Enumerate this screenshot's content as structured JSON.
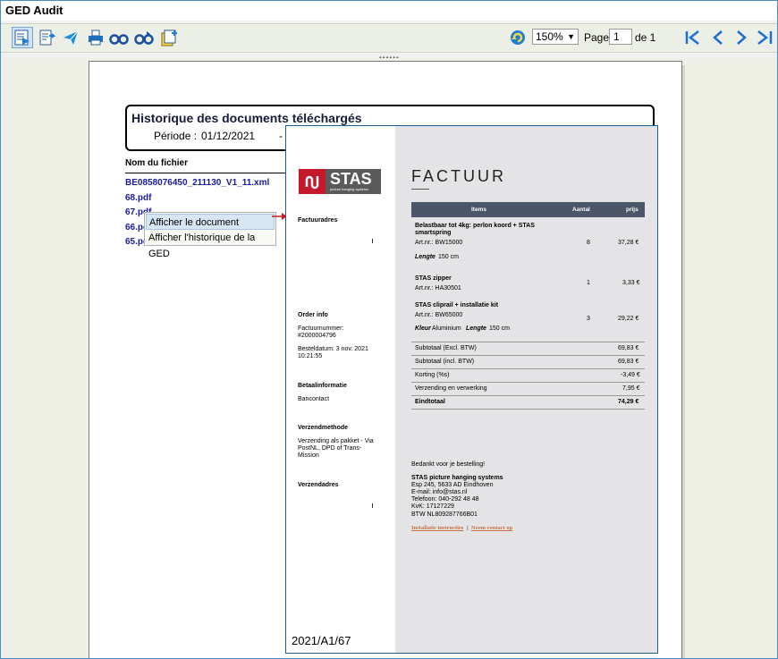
{
  "app": {
    "title": "GED Audit"
  },
  "toolbar": {
    "zoom_value": "150%",
    "page_label": "Page",
    "page_value": "1",
    "page_of": "de 1"
  },
  "report": {
    "title": "Historique des documents téléchargés",
    "period_label": "Période :",
    "period_start": "01/12/2021",
    "period_sep": "-",
    "column_header": "Nom du fichier",
    "files": [
      "BE0858076450_211130_V1_11.xml",
      "68.pdf",
      "67.pdf",
      "66.pdf",
      "65.pdf"
    ]
  },
  "context_menu": {
    "items": [
      "Afficher le document",
      "Afficher l'historique de la GED"
    ]
  },
  "invoice": {
    "logo_text": "STAS",
    "logo_sub": "picture hanging systems",
    "title": "FACTUUR",
    "billing_address_label": "Factuuradres",
    "order_info_label": "Order info",
    "invoice_number_label": "Factuurnummer:",
    "invoice_number": "#2000004796",
    "order_date_label": "Besteldatum: 3 nov. 2021",
    "order_time": "10:21:55",
    "payment_label": "Betaalinformatie",
    "payment_value": "Bancontact",
    "shipping_method_label": "Verzendmethode",
    "shipping_method_l1": "Verzending als pakket - Via",
    "shipping_method_l2": "PostNL, DPD of Trans-",
    "shipping_method_l3": "Mission",
    "shipping_address_label": "Verzendadres",
    "table_headers": {
      "items": "Items",
      "qty": "Aantal",
      "price": "prijs"
    },
    "item1_name_l1": "Belastbaar tot 4kg: perlon koord + STAS",
    "item1_name_l2": "smartspring",
    "item1_art": "Art.nr.: BW15000",
    "item1_qty": "8",
    "item1_price": "37,28 €",
    "item1_opt_label": "Lengte",
    "item1_opt_value": "150 cm",
    "item2_name": "STAS zipper",
    "item2_art": "Art.nr.: HA30501",
    "item2_qty": "1",
    "item2_price": "3,33 €",
    "item3_name": "STAS cliprail + installatie kit",
    "item3_art": "Art.nr.: BW65000",
    "item3_qty": "3",
    "item3_price": "29,22 €",
    "item3_opt1_label": "Kleur",
    "item3_opt1_value": "Aluminium",
    "item3_opt2_label": "Lengte",
    "item3_opt2_value": "150 cm",
    "subtotal_excl_label": "Subtotaal (Excl. BTW)",
    "subtotal_excl": "69,83 €",
    "subtotal_incl_label": "Subtotaal (incl. BTW)",
    "subtotal_incl": "69,83 €",
    "discount_label": "Korting (%s)",
    "discount": "-3,49 €",
    "shipping_label": "Verzending en verwerking",
    "shipping": "7,95 €",
    "total_label": "Eindtotaal",
    "total": "74,29 €",
    "thanks": "Bedankt voor je bestelling!",
    "company_name": "STAS picture hanging systems",
    "company_address": "Esp 245, 5633 AD Eindhoven",
    "company_email": "E-mail: info@stas.nl",
    "company_phone": "Telefoon: 040-292 48 48",
    "company_kvk": "KvK: 17127229",
    "company_btw": "BTW NL809287766B01",
    "link_install": "Installatie instructies",
    "link_sep": "|",
    "link_contact": "Neem contact op",
    "footer_ref": "2021/A1/67"
  }
}
